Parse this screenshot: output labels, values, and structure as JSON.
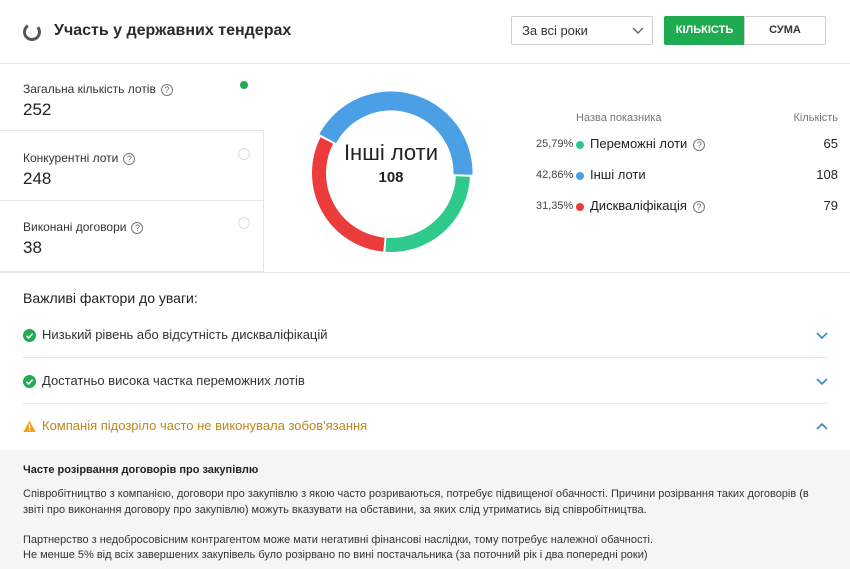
{
  "header": {
    "title": "Участь у державних тендерах",
    "period": "За всі роки",
    "btn_count": "КІЛЬКІСТЬ",
    "btn_sum": "СУМА",
    "accent": "#1fab4f"
  },
  "cards": [
    {
      "label": "Загальна кількість лотів",
      "value": "252",
      "selected": true
    },
    {
      "label": "Конкурентні лоти",
      "value": "248",
      "selected": false
    },
    {
      "label": "Виконані договори",
      "value": "38",
      "selected": false
    }
  ],
  "donut": {
    "center_label": "Інші лоти",
    "center_value": "108"
  },
  "legend": {
    "col_name": "Назва показника",
    "col_count": "Кількість",
    "rows": [
      {
        "pct": "25,79%",
        "name": "Переможні лоти",
        "value": "65",
        "color": "#2ec98b",
        "help": true
      },
      {
        "pct": "42,86%",
        "name": "Інші лоти",
        "value": "108",
        "color": "#4a9fe5",
        "help": false
      },
      {
        "pct": "31,35%",
        "name": "Дискваліфікація",
        "value": "79",
        "color": "#ec3b3b",
        "help": true
      }
    ]
  },
  "factors": {
    "title": "Важливі фактори до уваги:",
    "items": [
      {
        "text": "Низький рівень або відсутність дискваліфікацій",
        "status": "ok",
        "expanded": false
      },
      {
        "text": "Достатньо висока частка переможних лотів",
        "status": "ok",
        "expanded": false
      },
      {
        "text": "Компанія підозріло часто не виконувала зобов'язання",
        "status": "warning",
        "expanded": true
      }
    ]
  },
  "details": {
    "title": "Часте розірвання договорів про закупівлю",
    "p1": "Співробітництво з компанією, договори про закупівлю з якою часто розриваються, потребує підвищеної обачності. Причини розірвання таких договорів (в звіті про виконання договору про закупівлю) можуть вказувати на обставини, за яких слід утриматись від співробітництва.",
    "p2": "Партнерство з недобросовісним контрагентом може мати негативні фінансові наслідки, тому потребує належної обачності.",
    "p3": "Не менше 5% від всіх завершених закупівель було розірвано по вині постачальника (за поточний рік і два попередні роки)"
  }
}
